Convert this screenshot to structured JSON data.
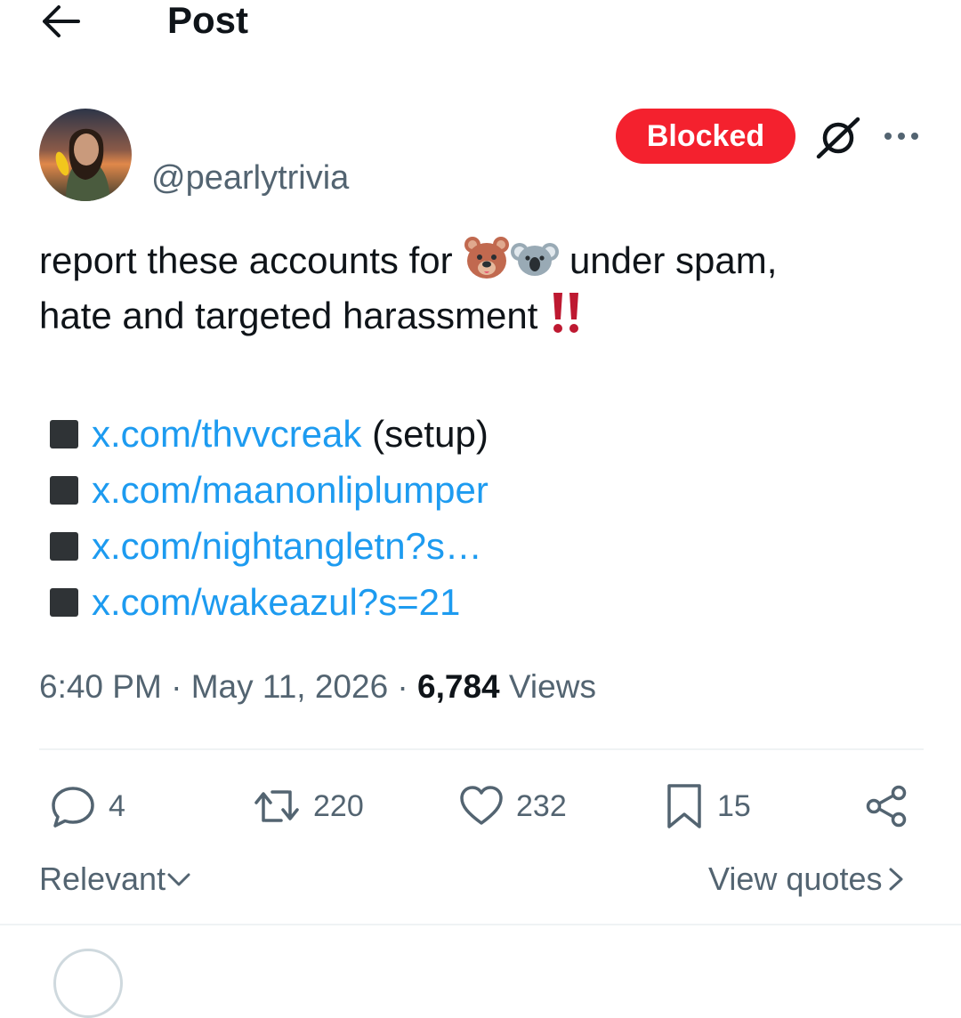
{
  "header": {
    "title": "Post",
    "back_icon": "arrow-left-icon"
  },
  "author": {
    "handle": "@pearlytrivia",
    "avatar": "user-avatar"
  },
  "actions_top": {
    "blocked_label": "Blocked",
    "grok_icon": "grok-icon",
    "more_icon": "more-horizontal-icon"
  },
  "post": {
    "line1_before": "report these accounts for ",
    "line1_after": " under spam,",
    "line2": "hate and targeted harassment ",
    "emojis": [
      "bear-face-emoji",
      "koala-emoji",
      "double-exclamation-emoji"
    ],
    "links": [
      {
        "text": "x.com/thvvcreak",
        "suffix": " (setup)"
      },
      {
        "text": "x.com/maanonliplumper",
        "suffix": ""
      },
      {
        "text": "x.com/nightangletn?s…",
        "suffix": ""
      },
      {
        "text": "x.com/wakeazul?s=21",
        "suffix": ""
      }
    ]
  },
  "meta": {
    "time": "6:40 PM",
    "sep1": " · ",
    "date": "May 11, 2026",
    "sep2": " · ",
    "views": "6,784",
    "views_label": " Views"
  },
  "stats": {
    "replies": "4",
    "reposts": "220",
    "likes": "232",
    "bookmarks": "15"
  },
  "footer": {
    "sort_label": "Relevant",
    "quotes_label": "View quotes"
  },
  "colors": {
    "accent": "#1d9bf0",
    "blocked": "#f4212e",
    "muted": "#536471"
  }
}
